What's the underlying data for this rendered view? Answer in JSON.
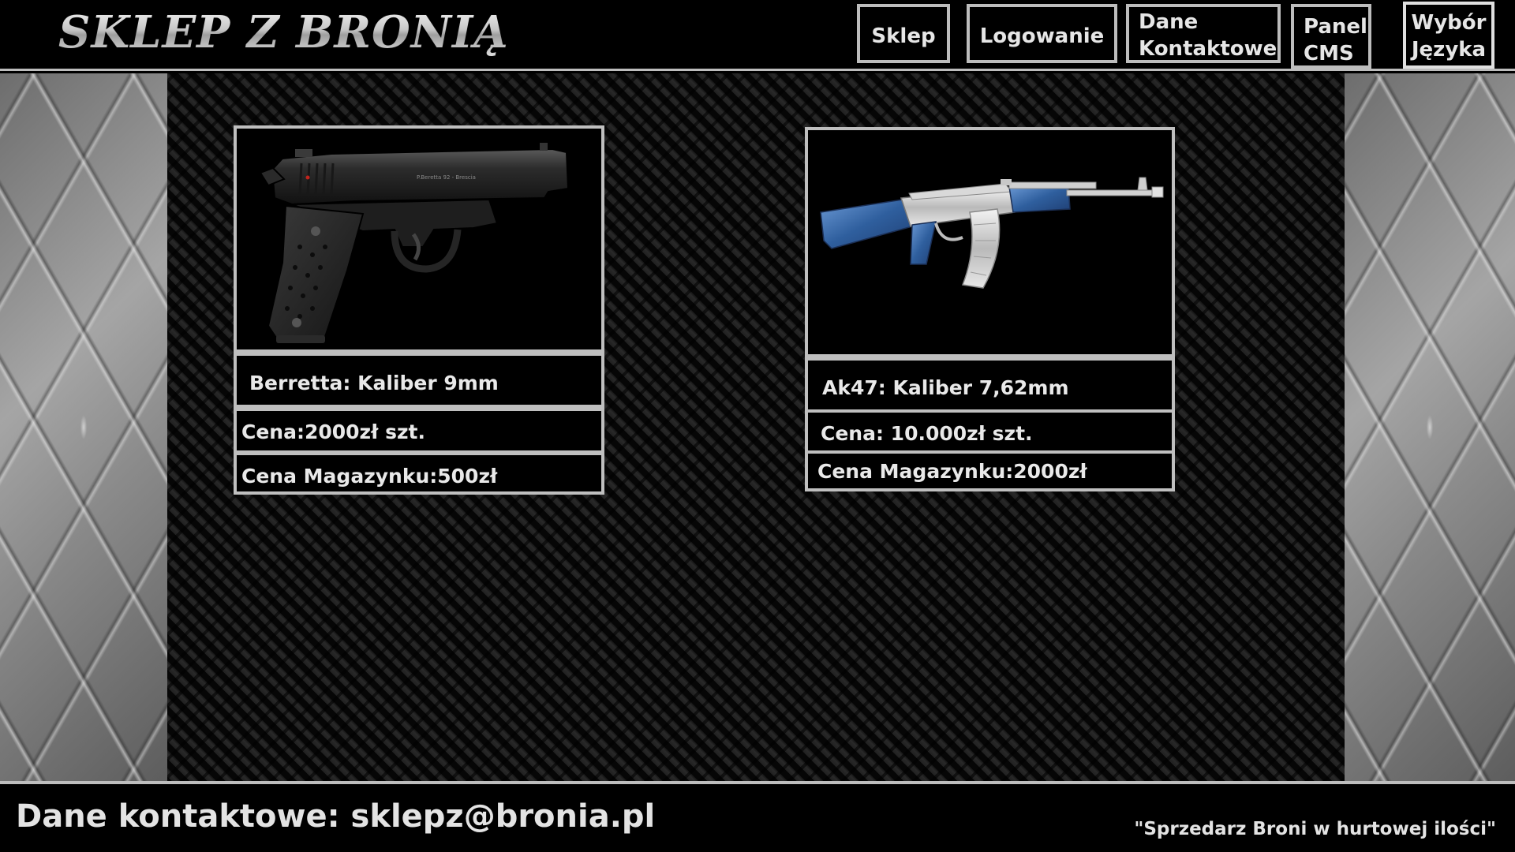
{
  "header": {
    "logo_text": "SKLEP Z BRONIĄ",
    "nav": [
      {
        "label_line1": "Sklep",
        "label_line2": ""
      },
      {
        "label_line1": "Logowanie",
        "label_line2": ""
      },
      {
        "label_line1": "Dane",
        "label_line2": "Kontaktowe"
      },
      {
        "label_line1": "Panel",
        "label_line2": "CMS"
      },
      {
        "label_line1": "Wybór",
        "label_line2": "Języka"
      }
    ]
  },
  "products": [
    {
      "name": "Berretta: Kaliber 9mm",
      "price": "Cena:2000zł szt.",
      "magazine_price": "Cena Magazynku:500zł",
      "image_icon": "pistol-icon"
    },
    {
      "name": "Ak47: Kaliber 7,62mm",
      "price": "Cena: 10.000zł szt.",
      "magazine_price": "Cena Magazynku:2000zł",
      "image_icon": "rifle-icon"
    }
  ],
  "footer": {
    "contact": "Dane kontaktowe: sklepz@bronia.pl",
    "slogan": "\"Sprzedarz Broni w hurtowej ilości\""
  },
  "colors": {
    "background": "#000000",
    "border": "#bdbdbd",
    "text": "#e6e6e6",
    "rifle_stock": "#3d6fb0"
  }
}
